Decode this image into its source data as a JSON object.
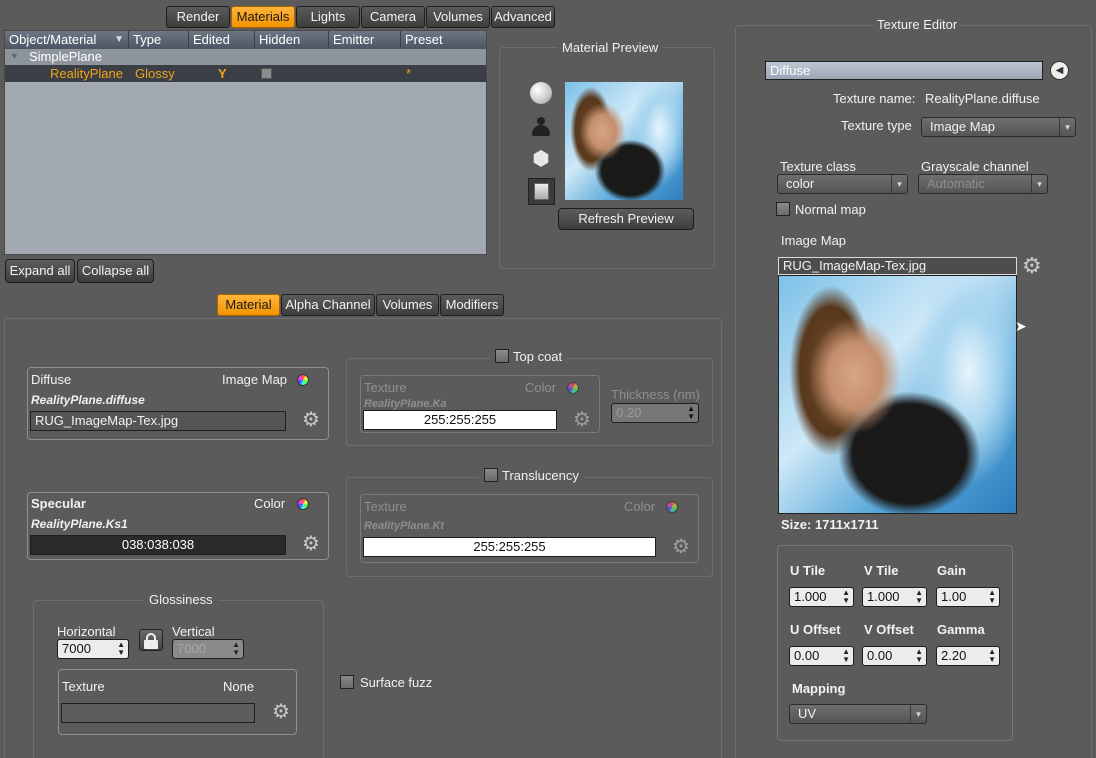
{
  "top_tabs": [
    "Render",
    "Materials",
    "Lights",
    "Camera",
    "Volumes",
    "Advanced"
  ],
  "table": {
    "columns": [
      "Object/Material",
      "Type",
      "Edited",
      "Hidden",
      "Emitter",
      "Preset"
    ],
    "sort_indicator": "▼",
    "group": "SimplePlane",
    "row": {
      "name": "RealityPlane",
      "type": "Glossy",
      "edited": "Y",
      "preset": "*"
    }
  },
  "buttons": {
    "expand_all": "Expand all",
    "collapse_all": "Collapse all",
    "refresh_preview": "Refresh Preview"
  },
  "material_preview": {
    "title": "Material Preview"
  },
  "sub_tabs": [
    "Material",
    "Alpha Channel",
    "Volumes",
    "Modifiers"
  ],
  "diffuse": {
    "title": "Diffuse",
    "mode": "Image Map",
    "channel": "RealityPlane.diffuse",
    "file": "RUG_ImageMap-Tex.jpg"
  },
  "specular": {
    "title": "Specular",
    "mode": "Color",
    "channel": "RealityPlane.Ks1",
    "value": "038:038:038"
  },
  "top_coat": {
    "title": "Top coat",
    "texture_label": "Texture",
    "mode": "Color",
    "channel": "RealityPlane.Ka",
    "value": "255:255:255",
    "thickness_label": "Thickness (nm)",
    "thickness": "0.20"
  },
  "translucency": {
    "title": "Translucency",
    "texture_label": "Texture",
    "mode": "Color",
    "channel": "RealityPlane.Kt",
    "value": "255:255:255"
  },
  "glossiness": {
    "title": "Glossiness",
    "horizontal_label": "Horizontal",
    "horizontal": "7000",
    "vertical_label": "Vertical",
    "vertical": "7000",
    "texture_label": "Texture",
    "texture_mode": "None"
  },
  "surface_fuzz": {
    "label": "Surface fuzz"
  },
  "texture_editor": {
    "title": "Texture Editor",
    "channel": "Diffuse",
    "texture_name_label": "Texture name:",
    "texture_name": "RealityPlane.diffuse",
    "texture_type_label": "Texture type",
    "texture_type": "Image Map",
    "texture_class_label": "Texture class",
    "texture_class": "color",
    "grayscale_label": "Grayscale channel",
    "grayscale": "Automatic",
    "normal_map_label": "Normal map",
    "image_map_label": "Image Map",
    "image_file": "RUG_ImageMap-Tex.jpg",
    "size_text": "Size: 1711x1711",
    "u_tile_label": "U Tile",
    "u_tile": "1.000",
    "v_tile_label": "V Tile",
    "v_tile": "1.000",
    "gain_label": "Gain",
    "gain": "1.00",
    "u_offset_label": "U Offset",
    "u_offset": "0.00",
    "v_offset_label": "V Offset",
    "v_offset": "0.00",
    "gamma_label": "Gamma",
    "gamma": "2.20",
    "mapping_label": "Mapping",
    "mapping": "UV"
  },
  "icons": [
    "sphere-icon",
    "figure-icon",
    "cube-icon",
    "plane-icon",
    "gear-icon",
    "color-wheel-icon",
    "lock-icon",
    "back-arrow-icon"
  ]
}
